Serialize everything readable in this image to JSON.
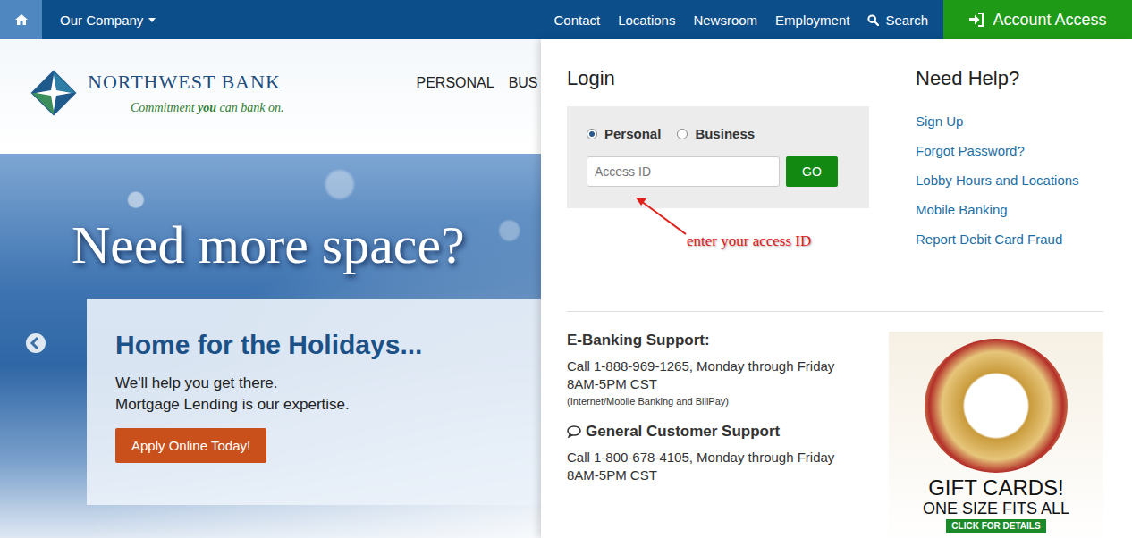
{
  "topbar": {
    "company_menu": "Our Company",
    "links": [
      "Contact",
      "Locations",
      "Newsroom",
      "Employment",
      "Search"
    ],
    "account_access": "Account Access"
  },
  "header": {
    "logo": {
      "name": "NORTHWEST BANK",
      "tagline_before": "Commitment ",
      "tagline_emphasis": "you",
      "tagline_after": " can bank on."
    },
    "nav": [
      "PERSONAL",
      "BUS"
    ]
  },
  "hero": {
    "headline": "Need more space?",
    "card": {
      "title": "Home for the Holidays...",
      "lines": [
        "We'll help you get there.",
        "Mortgage Lending is our expertise."
      ],
      "button": "Apply Online Today!"
    }
  },
  "login": {
    "title": "Login",
    "account_types": [
      {
        "label": "Personal",
        "selected": true
      },
      {
        "label": "Business",
        "selected": false
      }
    ],
    "input": {
      "placeholder": "Access ID",
      "value": ""
    },
    "button": "GO",
    "annotation": "enter your access ID"
  },
  "help": {
    "title": "Need Help?",
    "links": [
      "Sign Up",
      "Forgot Password?",
      "Lobby Hours and Locations",
      "Mobile Banking",
      "Report Debit Card Fraud"
    ]
  },
  "support": [
    {
      "kind": "plain",
      "title": "E-Banking Support:",
      "lines": [
        "Call 1-888-969-1265, Monday through Friday",
        "8AM-5PM CST"
      ],
      "note": "(Internet/Mobile Banking and BillPay)"
    },
    {
      "kind": "chat",
      "title": "General Customer Support",
      "lines": [
        "Call 1-800-678-4105, Monday through Friday",
        "8AM-5PM CST"
      ],
      "note": ""
    }
  ],
  "promo": {
    "title": "GIFT CARDS!",
    "subtitle": "ONE SIZE FITS ALL",
    "button": "CLICK FOR DETAILS"
  }
}
